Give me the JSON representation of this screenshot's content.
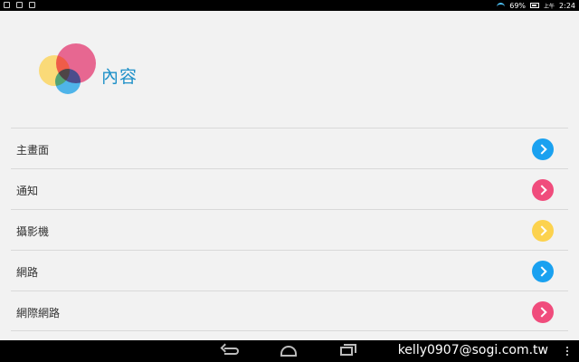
{
  "status_bar": {
    "battery": "69%",
    "ampm": "上午",
    "time": "2:24"
  },
  "header": {
    "title": "內容"
  },
  "list": {
    "items": [
      {
        "label": "主畫面",
        "color": "#1aa1f0"
      },
      {
        "label": "通知",
        "color": "#f04c7c"
      },
      {
        "label": "攝影機",
        "color": "#fcd24e"
      },
      {
        "label": "網路",
        "color": "#1aa1f0"
      },
      {
        "label": "網際網路",
        "color": "#f04c7c"
      }
    ]
  },
  "watermark": "kelly0907@sogi.com.tw",
  "icons": {
    "back": "back-icon",
    "home": "home-icon",
    "recent": "recent-apps-icon",
    "menu": "overflow-menu-icon",
    "arrow": "chevron-right-icon"
  }
}
